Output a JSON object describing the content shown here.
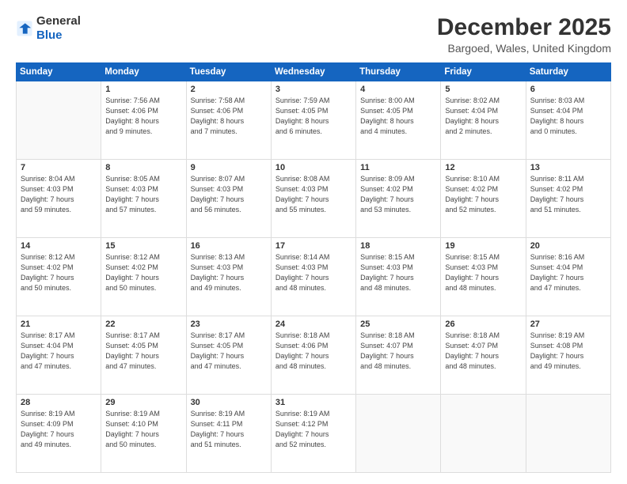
{
  "header": {
    "logo_general": "General",
    "logo_blue": "Blue",
    "month_title": "December 2025",
    "location": "Bargoed, Wales, United Kingdom"
  },
  "days_of_week": [
    "Sunday",
    "Monday",
    "Tuesday",
    "Wednesday",
    "Thursday",
    "Friday",
    "Saturday"
  ],
  "weeks": [
    [
      {
        "day": "",
        "info": ""
      },
      {
        "day": "1",
        "info": "Sunrise: 7:56 AM\nSunset: 4:06 PM\nDaylight: 8 hours\nand 9 minutes."
      },
      {
        "day": "2",
        "info": "Sunrise: 7:58 AM\nSunset: 4:06 PM\nDaylight: 8 hours\nand 7 minutes."
      },
      {
        "day": "3",
        "info": "Sunrise: 7:59 AM\nSunset: 4:05 PM\nDaylight: 8 hours\nand 6 minutes."
      },
      {
        "day": "4",
        "info": "Sunrise: 8:00 AM\nSunset: 4:05 PM\nDaylight: 8 hours\nand 4 minutes."
      },
      {
        "day": "5",
        "info": "Sunrise: 8:02 AM\nSunset: 4:04 PM\nDaylight: 8 hours\nand 2 minutes."
      },
      {
        "day": "6",
        "info": "Sunrise: 8:03 AM\nSunset: 4:04 PM\nDaylight: 8 hours\nand 0 minutes."
      }
    ],
    [
      {
        "day": "7",
        "info": "Sunrise: 8:04 AM\nSunset: 4:03 PM\nDaylight: 7 hours\nand 59 minutes."
      },
      {
        "day": "8",
        "info": "Sunrise: 8:05 AM\nSunset: 4:03 PM\nDaylight: 7 hours\nand 57 minutes."
      },
      {
        "day": "9",
        "info": "Sunrise: 8:07 AM\nSunset: 4:03 PM\nDaylight: 7 hours\nand 56 minutes."
      },
      {
        "day": "10",
        "info": "Sunrise: 8:08 AM\nSunset: 4:03 PM\nDaylight: 7 hours\nand 55 minutes."
      },
      {
        "day": "11",
        "info": "Sunrise: 8:09 AM\nSunset: 4:02 PM\nDaylight: 7 hours\nand 53 minutes."
      },
      {
        "day": "12",
        "info": "Sunrise: 8:10 AM\nSunset: 4:02 PM\nDaylight: 7 hours\nand 52 minutes."
      },
      {
        "day": "13",
        "info": "Sunrise: 8:11 AM\nSunset: 4:02 PM\nDaylight: 7 hours\nand 51 minutes."
      }
    ],
    [
      {
        "day": "14",
        "info": "Sunrise: 8:12 AM\nSunset: 4:02 PM\nDaylight: 7 hours\nand 50 minutes."
      },
      {
        "day": "15",
        "info": "Sunrise: 8:12 AM\nSunset: 4:02 PM\nDaylight: 7 hours\nand 50 minutes."
      },
      {
        "day": "16",
        "info": "Sunrise: 8:13 AM\nSunset: 4:03 PM\nDaylight: 7 hours\nand 49 minutes."
      },
      {
        "day": "17",
        "info": "Sunrise: 8:14 AM\nSunset: 4:03 PM\nDaylight: 7 hours\nand 48 minutes."
      },
      {
        "day": "18",
        "info": "Sunrise: 8:15 AM\nSunset: 4:03 PM\nDaylight: 7 hours\nand 48 minutes."
      },
      {
        "day": "19",
        "info": "Sunrise: 8:15 AM\nSunset: 4:03 PM\nDaylight: 7 hours\nand 48 minutes."
      },
      {
        "day": "20",
        "info": "Sunrise: 8:16 AM\nSunset: 4:04 PM\nDaylight: 7 hours\nand 47 minutes."
      }
    ],
    [
      {
        "day": "21",
        "info": "Sunrise: 8:17 AM\nSunset: 4:04 PM\nDaylight: 7 hours\nand 47 minutes."
      },
      {
        "day": "22",
        "info": "Sunrise: 8:17 AM\nSunset: 4:05 PM\nDaylight: 7 hours\nand 47 minutes."
      },
      {
        "day": "23",
        "info": "Sunrise: 8:17 AM\nSunset: 4:05 PM\nDaylight: 7 hours\nand 47 minutes."
      },
      {
        "day": "24",
        "info": "Sunrise: 8:18 AM\nSunset: 4:06 PM\nDaylight: 7 hours\nand 48 minutes."
      },
      {
        "day": "25",
        "info": "Sunrise: 8:18 AM\nSunset: 4:07 PM\nDaylight: 7 hours\nand 48 minutes."
      },
      {
        "day": "26",
        "info": "Sunrise: 8:18 AM\nSunset: 4:07 PM\nDaylight: 7 hours\nand 48 minutes."
      },
      {
        "day": "27",
        "info": "Sunrise: 8:19 AM\nSunset: 4:08 PM\nDaylight: 7 hours\nand 49 minutes."
      }
    ],
    [
      {
        "day": "28",
        "info": "Sunrise: 8:19 AM\nSunset: 4:09 PM\nDaylight: 7 hours\nand 49 minutes."
      },
      {
        "day": "29",
        "info": "Sunrise: 8:19 AM\nSunset: 4:10 PM\nDaylight: 7 hours\nand 50 minutes."
      },
      {
        "day": "30",
        "info": "Sunrise: 8:19 AM\nSunset: 4:11 PM\nDaylight: 7 hours\nand 51 minutes."
      },
      {
        "day": "31",
        "info": "Sunrise: 8:19 AM\nSunset: 4:12 PM\nDaylight: 7 hours\nand 52 minutes."
      },
      {
        "day": "",
        "info": ""
      },
      {
        "day": "",
        "info": ""
      },
      {
        "day": "",
        "info": ""
      }
    ]
  ]
}
